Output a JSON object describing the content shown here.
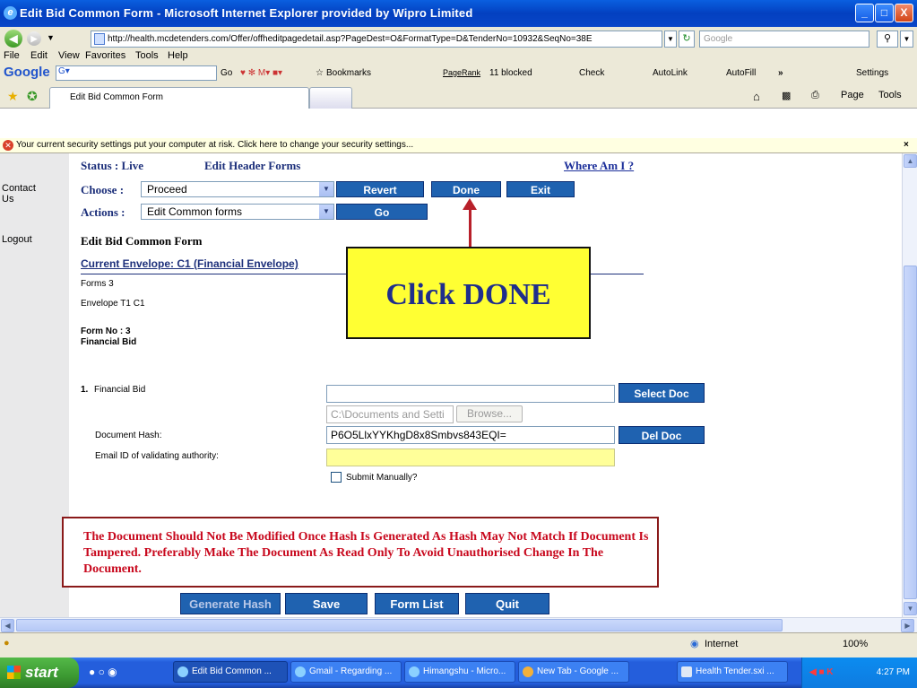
{
  "window": {
    "title": "Edit Bid Common Form - Microsoft Internet Explorer provided by Wipro Limited",
    "minimize": "_",
    "maximize": "□",
    "close": "X"
  },
  "address": {
    "url": "http://health.mcdetenders.com/Offer/offheditpagedetail.asp?PageDest=O&FormatType=D&TenderNo=10932&SeqNo=38E",
    "search_placeholder": "Google"
  },
  "menu": [
    "File",
    "Edit",
    "View",
    "Favorites",
    "Tools",
    "Help"
  ],
  "google_toolbar": {
    "logo": "Google",
    "go": "Go",
    "bookmarks": "Bookmarks",
    "pagerank": "PageRank",
    "blocked": "11 blocked",
    "check": "Check",
    "autolink": "AutoLink",
    "autofill": "AutoFill",
    "more": "»",
    "settings": "Settings"
  },
  "tabs": {
    "active": "Edit Bid Common Form",
    "page_btn": "Page",
    "tools_btn": "Tools"
  },
  "infobar": "Your current security settings put your computer at risk. Click here to change your security settings...",
  "leftnav": {
    "contact": "Contact Us",
    "logout": "Logout"
  },
  "header": {
    "status": "Status : Live",
    "edit_header": "Edit Header Forms",
    "where_am_i": "Where Am I ?"
  },
  "choose": {
    "label": "Choose :",
    "value": "Proceed",
    "revert": "Revert",
    "done": "Done",
    "exit": "Exit"
  },
  "actions": {
    "label": "Actions :",
    "value": "Edit Common forms",
    "go": "Go"
  },
  "form": {
    "heading": "Edit Bid Common Form",
    "envelope": "Current Envelope: C1 (Financial Envelope)",
    "forms": "Forms 3",
    "envelope_t": "Envelope T1 C1",
    "form_no": "Form No : 3",
    "form_name": "Financial Bid"
  },
  "callout": "Click DONE",
  "doc": {
    "item_no": "1.",
    "item_label": "Financial Bid",
    "select_doc": "Select Doc",
    "path_value": "C:\\Documents and Setti",
    "browse": "Browse...",
    "hash_label": "Document Hash:",
    "hash_value": "P6O5LlxYYKhgD8x8Smbvs843EQI=",
    "del_doc": "Del Doc",
    "email_label": "Email ID of validating authority:",
    "submit_manually": "Submit Manually?"
  },
  "warning": "The Document Should Not Be Modified Once Hash Is Generated As Hash May Not Match If Document Is Tampered. Preferably Make The Document As Read Only To Avoid Unauthorised Change In The Document.",
  "bottom_buttons": {
    "generate": "Generate Hash",
    "save": "Save",
    "formlist": "Form List",
    "quit": "Quit"
  },
  "status": {
    "zone": "Internet",
    "zoom": "100%"
  },
  "taskbar": {
    "start": "start",
    "items": [
      "Edit Bid Common ...",
      "Gmail - Regarding ...",
      "Himangshu - Micro...",
      "New Tab - Google ...",
      "Health Tender.sxi ..."
    ],
    "clock": "4:27 PM"
  }
}
